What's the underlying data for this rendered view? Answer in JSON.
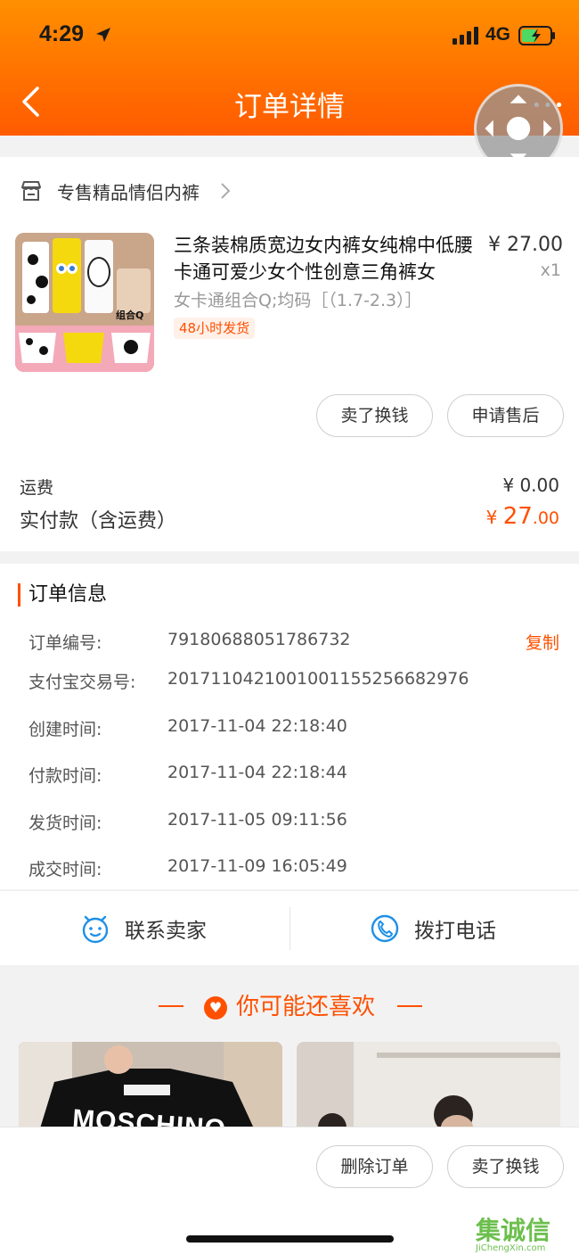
{
  "status_bar": {
    "time": "4:29",
    "network": "4G"
  },
  "header": {
    "title": "订单详情"
  },
  "shop": {
    "name": "专售精品情侣内裤"
  },
  "product": {
    "title": "三条装棉质宽边女内裤女纯棉中低腰卡通可爱少女个性创意三角裤女",
    "price": "¥ 27.00",
    "qty": "x1",
    "spec": "女卡通组合Q;均码［（1.7-2.3）］",
    "ship_tag": "48小时发货",
    "image_caption": "组合Q"
  },
  "product_buttons": {
    "sell": "卖了换钱",
    "after_sale": "申请售后"
  },
  "fees": {
    "shipping_label": "运费",
    "shipping_value": "¥ 0.00",
    "paid_label": "实付款（含运费）",
    "paid_symbol": "¥",
    "paid_int": "27",
    "paid_dec": ".00"
  },
  "order_info": {
    "title": "订单信息",
    "copy_label": "复制",
    "rows": [
      {
        "label": "订单编号:",
        "value": "79180688051786732"
      },
      {
        "label": "支付宝交易号:",
        "value": "2017110421001001155256682976"
      },
      {
        "label": "创建时间:",
        "value": "2017-11-04 22:18:40"
      },
      {
        "label": "付款时间:",
        "value": "2017-11-04 22:18:44"
      },
      {
        "label": "发货时间:",
        "value": "2017-11-05 09:11:56"
      },
      {
        "label": "成交时间:",
        "value": "2017-11-09 16:05:49"
      }
    ]
  },
  "actions": {
    "contact_seller": "联系卖家",
    "call": "拨打电话"
  },
  "recommend": {
    "title": "你可能还喜欢",
    "item1_text": "MOSCHINO"
  },
  "footer": {
    "delete": "删除订单",
    "sell": "卖了换钱"
  },
  "watermark": {
    "main": "集诚信",
    "sub": "JiChengXin.com"
  },
  "colors": {
    "accent": "#ff5000",
    "header_top": "#ff9000",
    "header_bottom": "#ff5b00"
  }
}
